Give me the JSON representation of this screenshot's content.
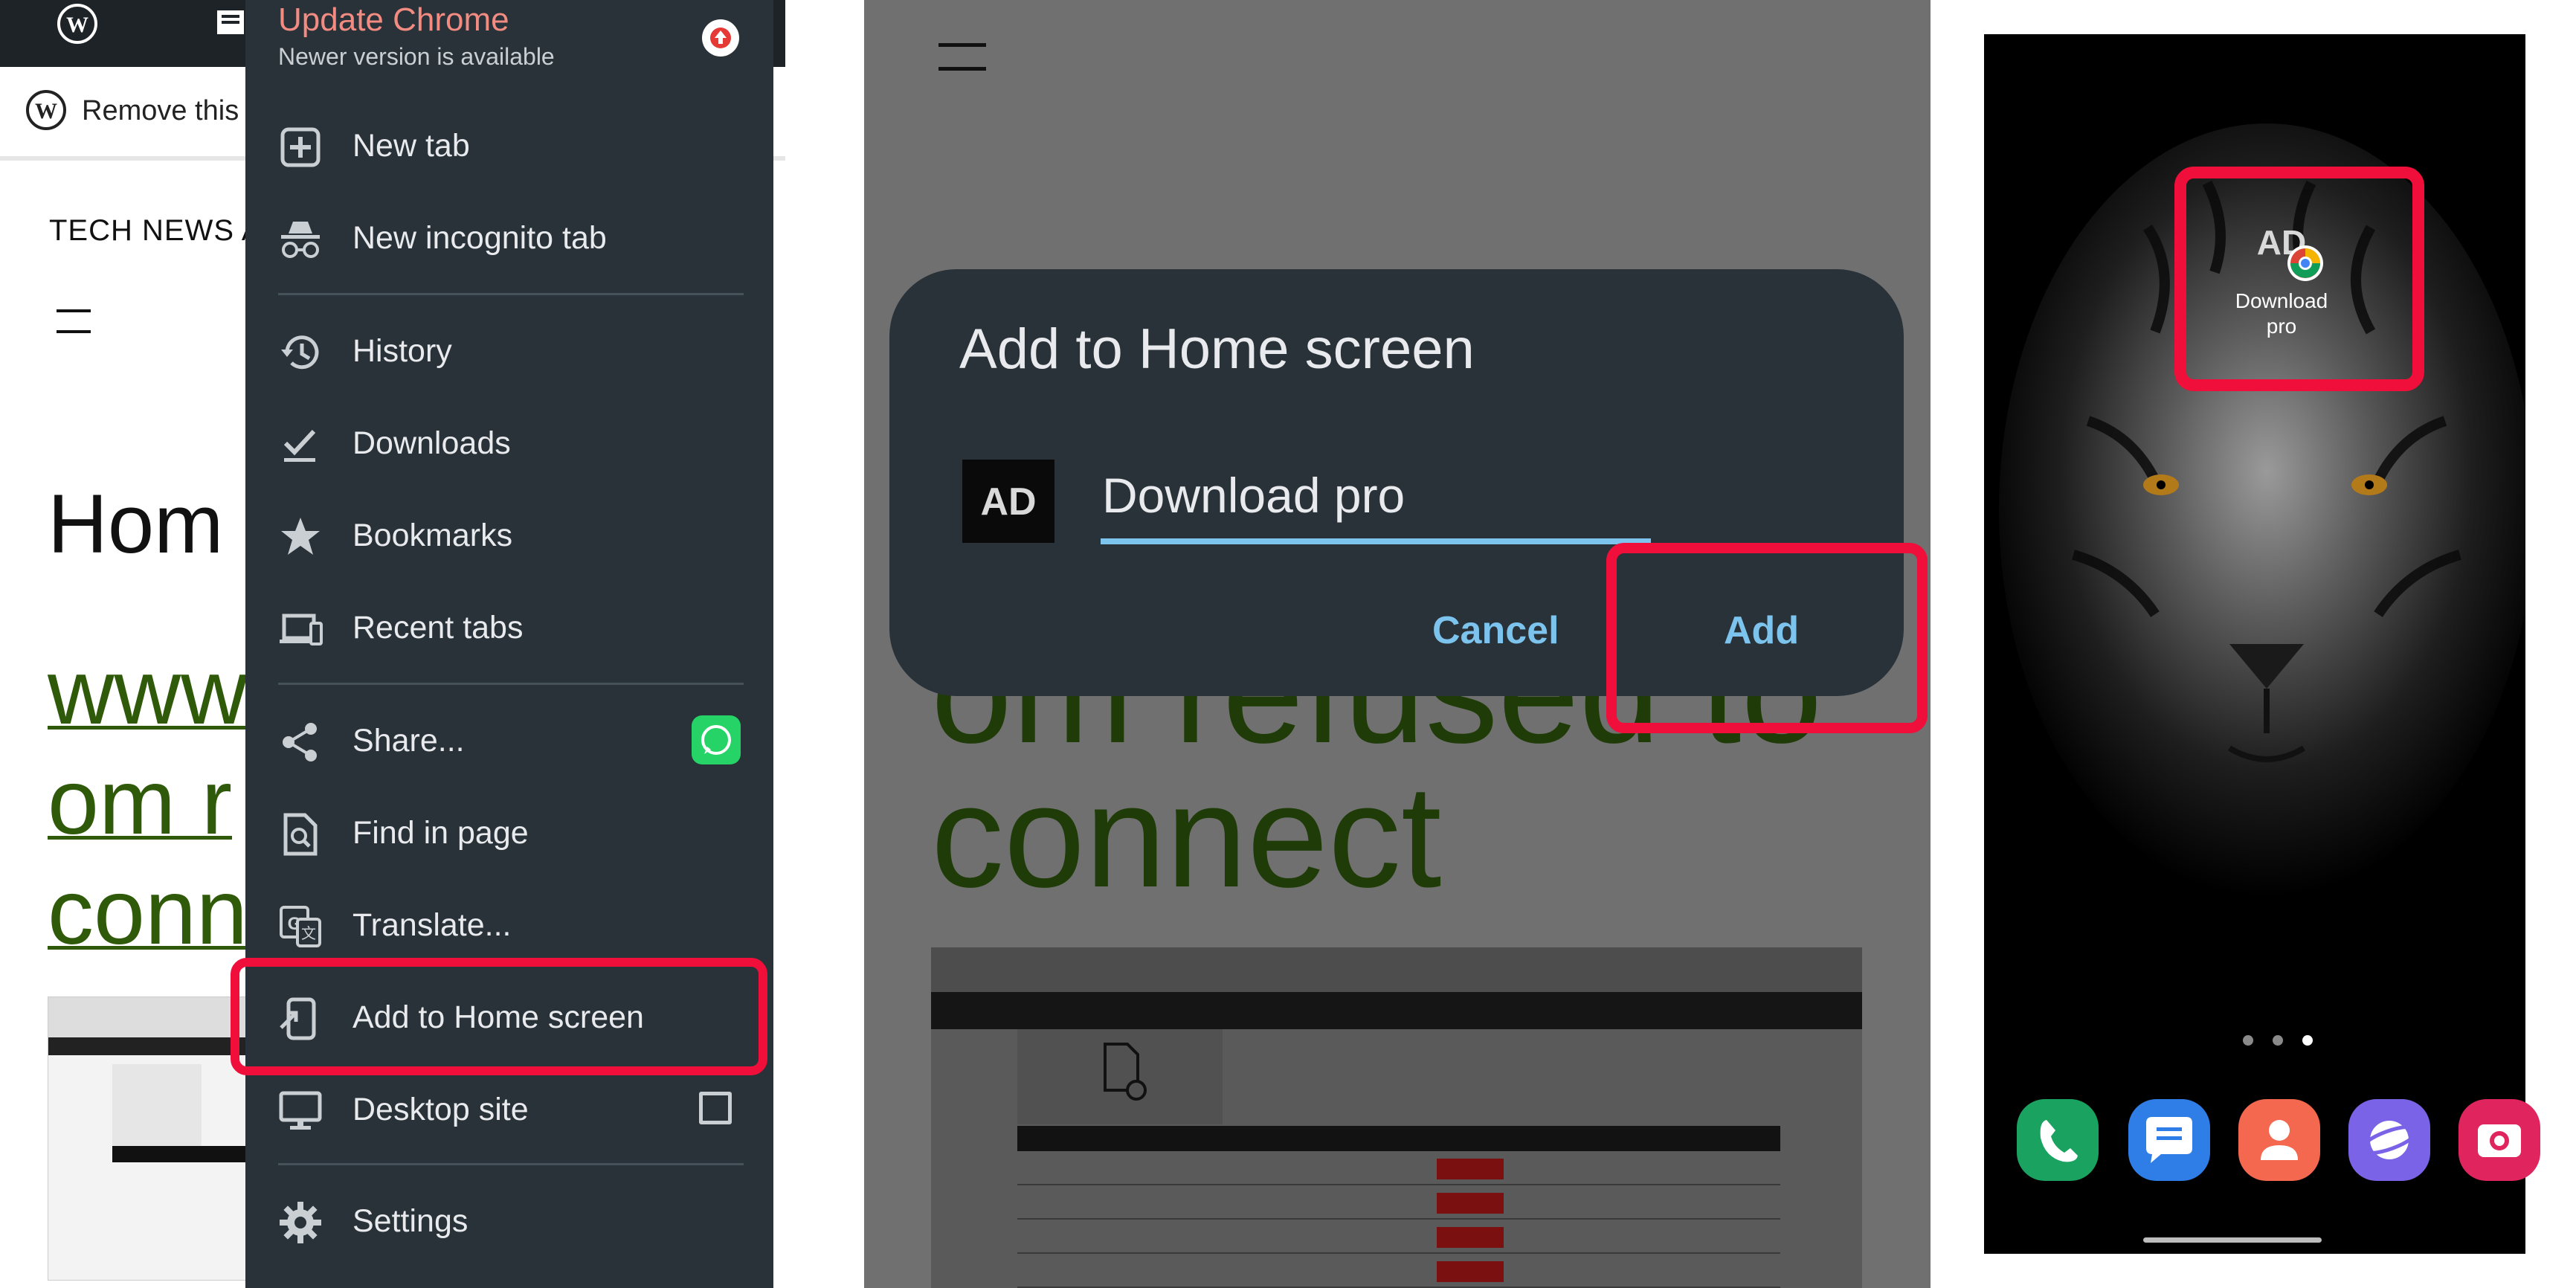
{
  "panel1": {
    "notice_text": "Remove this",
    "site_title": "TECH NEWS A",
    "page_heading": "Hom",
    "link_lines": [
      "www",
      "om r",
      "conn"
    ],
    "chrome_menu": {
      "update_title": "Update Chrome",
      "update_subtitle": "Newer version is available",
      "items": [
        {
          "label": "New tab",
          "icon": "new-tab-icon"
        },
        {
          "label": "New incognito tab",
          "icon": "incognito-icon"
        },
        {
          "label": "History",
          "icon": "history-icon"
        },
        {
          "label": "Downloads",
          "icon": "downloads-icon"
        },
        {
          "label": "Bookmarks",
          "icon": "star-icon"
        },
        {
          "label": "Recent tabs",
          "icon": "devices-icon"
        },
        {
          "label": "Share...",
          "icon": "share-icon"
        },
        {
          "label": "Find in page",
          "icon": "find-in-page-icon"
        },
        {
          "label": "Translate...",
          "icon": "translate-icon"
        },
        {
          "label": "Add to Home screen",
          "icon": "add-to-home-icon"
        },
        {
          "label": "Desktop site",
          "icon": "desktop-icon"
        },
        {
          "label": "Settings",
          "icon": "gear-icon"
        }
      ],
      "desktop_site_checked": false
    }
  },
  "panel2": {
    "background_link_lines": [
      "om refused to",
      "connect"
    ],
    "dialog": {
      "title": "Add to Home screen",
      "app_name_value": "Download pro",
      "icon_text": "AD",
      "cancel_label": "Cancel",
      "add_label": "Add"
    }
  },
  "panel3": {
    "shortcut_label_line1": "Download",
    "shortcut_label_line2": "pro",
    "page_indicator_active": 3,
    "dock_apps": [
      {
        "icon": "phone-icon",
        "color": "#1aa260"
      },
      {
        "icon": "messages-icon",
        "color": "#2f7ee8"
      },
      {
        "icon": "contacts-icon",
        "color": "#f3684e"
      },
      {
        "icon": "internet-icon",
        "color": "#7a63e6"
      },
      {
        "icon": "camera-icon",
        "color": "#e0245e"
      }
    ]
  },
  "colors": {
    "highlight": "#ef0f3a",
    "menu_bg": "#283238",
    "dialog_accent": "#7cc3ee",
    "link_green": "#2e5a0a"
  }
}
